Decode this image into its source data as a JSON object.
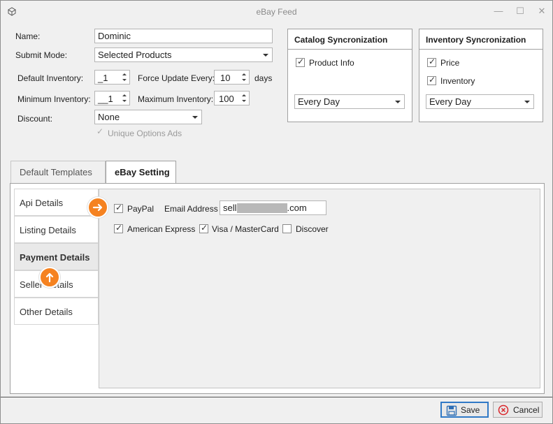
{
  "window": {
    "title": "eBay Feed",
    "controls": [
      "minimize-icon",
      "maximize-icon",
      "close-icon"
    ]
  },
  "form": {
    "name_label": "Name:",
    "name_value": "Dominic",
    "submit_mode_label": "Submit Mode:",
    "submit_mode_value": "Selected Products",
    "default_inventory_label": "Default Inventory:",
    "default_inventory_value": "_1",
    "force_update_label": "Force Update Every:",
    "force_update_value": "10",
    "force_update_unit": "days",
    "minimum_inventory_label": "Minimum Inventory:",
    "minimum_inventory_value": "__1",
    "maximum_inventory_label": "Maximum Inventory:",
    "maximum_inventory_value": "100",
    "discount_label": "Discount:",
    "discount_value": "None",
    "unique_options_label": "Unique Options Ads",
    "unique_options_checked": true
  },
  "catalog_sync": {
    "title": "Catalog Syncronization",
    "product_info_label": "Product Info",
    "product_info_checked": true,
    "frequency_value": "Every Day"
  },
  "inventory_sync": {
    "title": "Inventory Syncronization",
    "price_label": "Price",
    "price_checked": true,
    "inventory_label": "Inventory",
    "inventory_checked": true,
    "frequency_value": "Every Day"
  },
  "tabs": [
    {
      "label": "Default Templates",
      "active": false
    },
    {
      "label": "eBay Setting",
      "active": true
    }
  ],
  "nav": [
    {
      "label": "Api Details",
      "selected": false
    },
    {
      "label": "Listing Details",
      "selected": false
    },
    {
      "label": "Payment Details",
      "selected": true
    },
    {
      "label": "Seller Details",
      "selected": false
    },
    {
      "label": "Other Details",
      "selected": false
    }
  ],
  "payment": {
    "paypal_label": "PayPal",
    "paypal_checked": true,
    "email_label": "Email Address",
    "email_prefix": "sell",
    "email_suffix": ".com",
    "amex_label": "American Express",
    "amex_checked": true,
    "visa_label": "Visa / MasterCard",
    "visa_checked": true,
    "discover_label": "Discover",
    "discover_checked": false
  },
  "buttons": {
    "save_label": "Save",
    "cancel_label": "Cancel"
  },
  "colors": {
    "hint_orange": "#f58220",
    "primary_border": "#3079c6",
    "cancel_red": "#d9262b",
    "save_blue": "#2f6fb5"
  }
}
